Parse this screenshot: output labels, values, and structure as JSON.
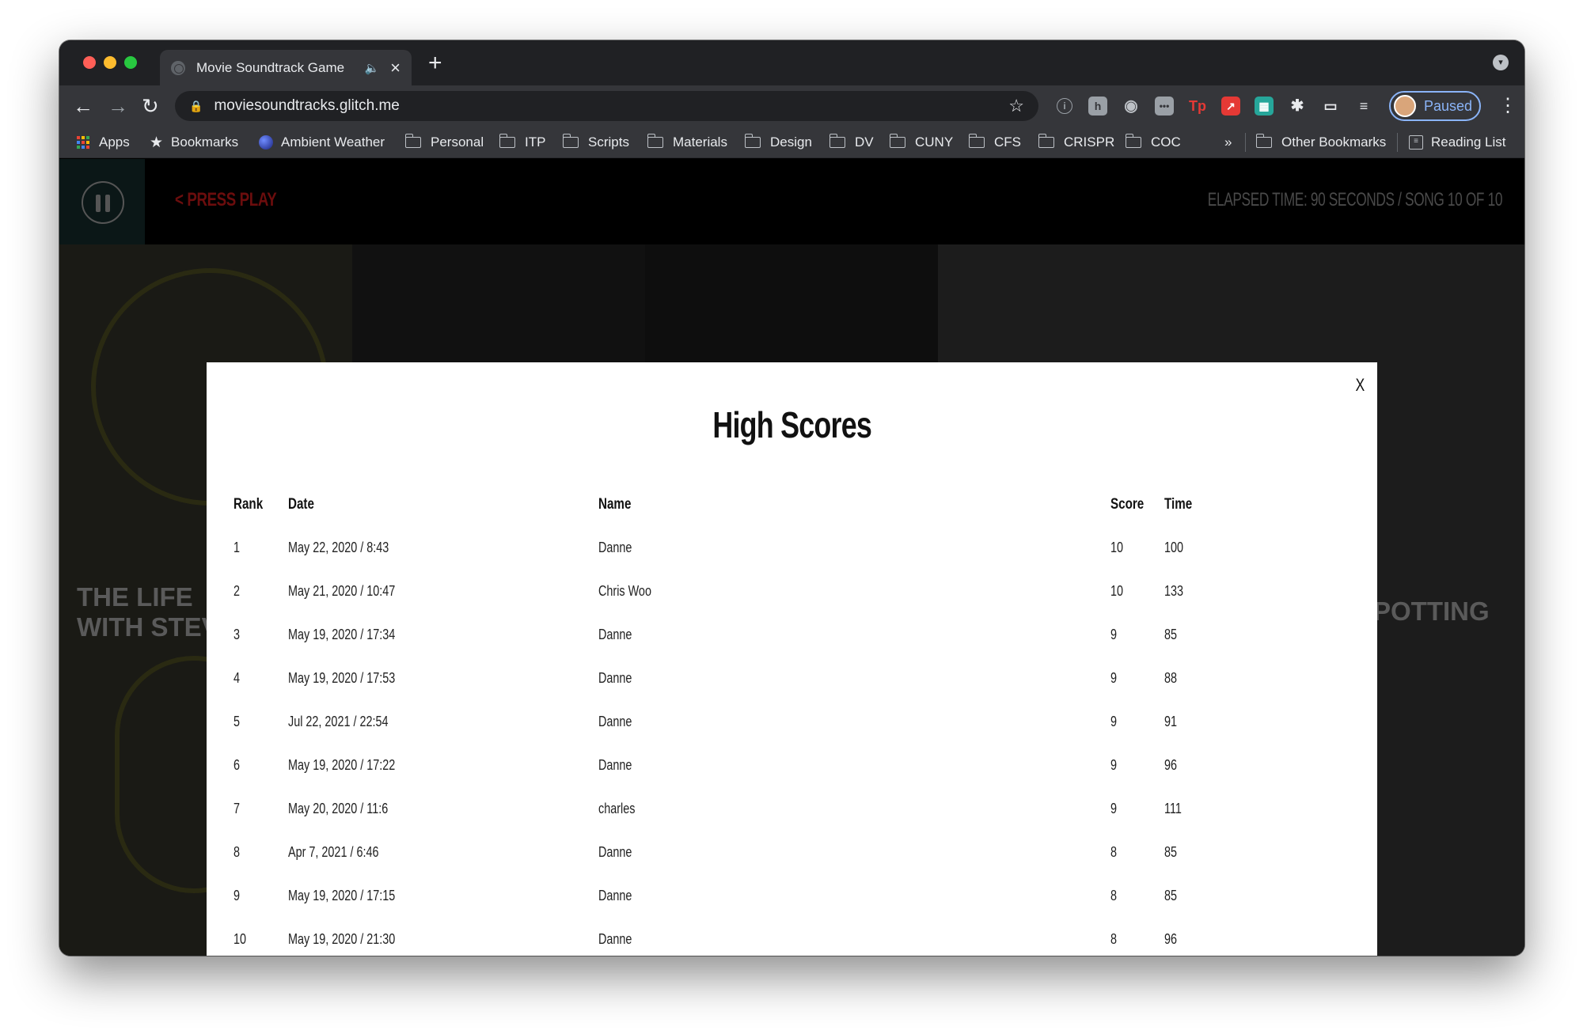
{
  "browser": {
    "tab_title": "Movie Soundtrack Game",
    "new_tab": "+",
    "url": "moviesoundtracks.glitch.me",
    "profile_label": "Paused",
    "bookmarks": [
      {
        "label": "Apps",
        "icon": "apps-grid-icon"
      },
      {
        "label": "Bookmarks",
        "icon": "star-icon"
      },
      {
        "label": "Ambient Weather",
        "icon": "globe-icon"
      },
      {
        "label": "Personal",
        "icon": "folder-icon"
      },
      {
        "label": "ITP",
        "icon": "folder-icon"
      },
      {
        "label": "Scripts",
        "icon": "folder-icon"
      },
      {
        "label": "Materials",
        "icon": "folder-icon"
      },
      {
        "label": "Design",
        "icon": "folder-icon"
      },
      {
        "label": "DV",
        "icon": "folder-icon"
      },
      {
        "label": "CUNY",
        "icon": "folder-icon"
      },
      {
        "label": "CFS",
        "icon": "folder-icon"
      },
      {
        "label": "CRISPR",
        "icon": "folder-icon"
      },
      {
        "label": "COC",
        "icon": "folder-icon"
      }
    ],
    "overflow": "»",
    "other_bookmarks": "Other Bookmarks",
    "reading_list": "Reading List"
  },
  "game": {
    "press_play": "< PRESS PLAY",
    "status": "ELAPSED TIME: 90 SECONDS / SONG 10 OF 10",
    "bg_left_text": [
      "THE LIFE",
      "WITH STEV"
    ],
    "bg_right_text": "POTTING"
  },
  "modal": {
    "close": "X",
    "title": "High Scores",
    "columns": [
      "Rank",
      "Date",
      "Name",
      "Score",
      "Time"
    ],
    "rows": [
      {
        "rank": "1",
        "date": "May 22, 2020 / 8:43",
        "name": "Danne",
        "score": "10",
        "time": "100"
      },
      {
        "rank": "2",
        "date": "May 21, 2020 / 10:47",
        "name": "Chris Woo",
        "score": "10",
        "time": "133"
      },
      {
        "rank": "3",
        "date": "May 19, 2020 / 17:34",
        "name": "Danne",
        "score": "9",
        "time": "85"
      },
      {
        "rank": "4",
        "date": "May 19, 2020 / 17:53",
        "name": "Danne",
        "score": "9",
        "time": "88"
      },
      {
        "rank": "5",
        "date": "Jul 22, 2021 / 22:54",
        "name": "Danne",
        "score": "9",
        "time": "91"
      },
      {
        "rank": "6",
        "date": "May 19, 2020 / 17:22",
        "name": "Danne",
        "score": "9",
        "time": "96"
      },
      {
        "rank": "7",
        "date": "May 20, 2020 / 11:6",
        "name": "charles",
        "score": "9",
        "time": "111"
      },
      {
        "rank": "8",
        "date": "Apr 7, 2021 / 6:46",
        "name": "Danne",
        "score": "8",
        "time": "85"
      },
      {
        "rank": "9",
        "date": "May 19, 2020 / 17:15",
        "name": "Danne",
        "score": "8",
        "time": "85"
      },
      {
        "rank": "10",
        "date": "May 19, 2020 / 21:30",
        "name": "Danne",
        "score": "8",
        "time": "96"
      }
    ]
  },
  "colors": {
    "accent_red": "#7a0c0c",
    "profile_blue": "#8ab4f8"
  }
}
